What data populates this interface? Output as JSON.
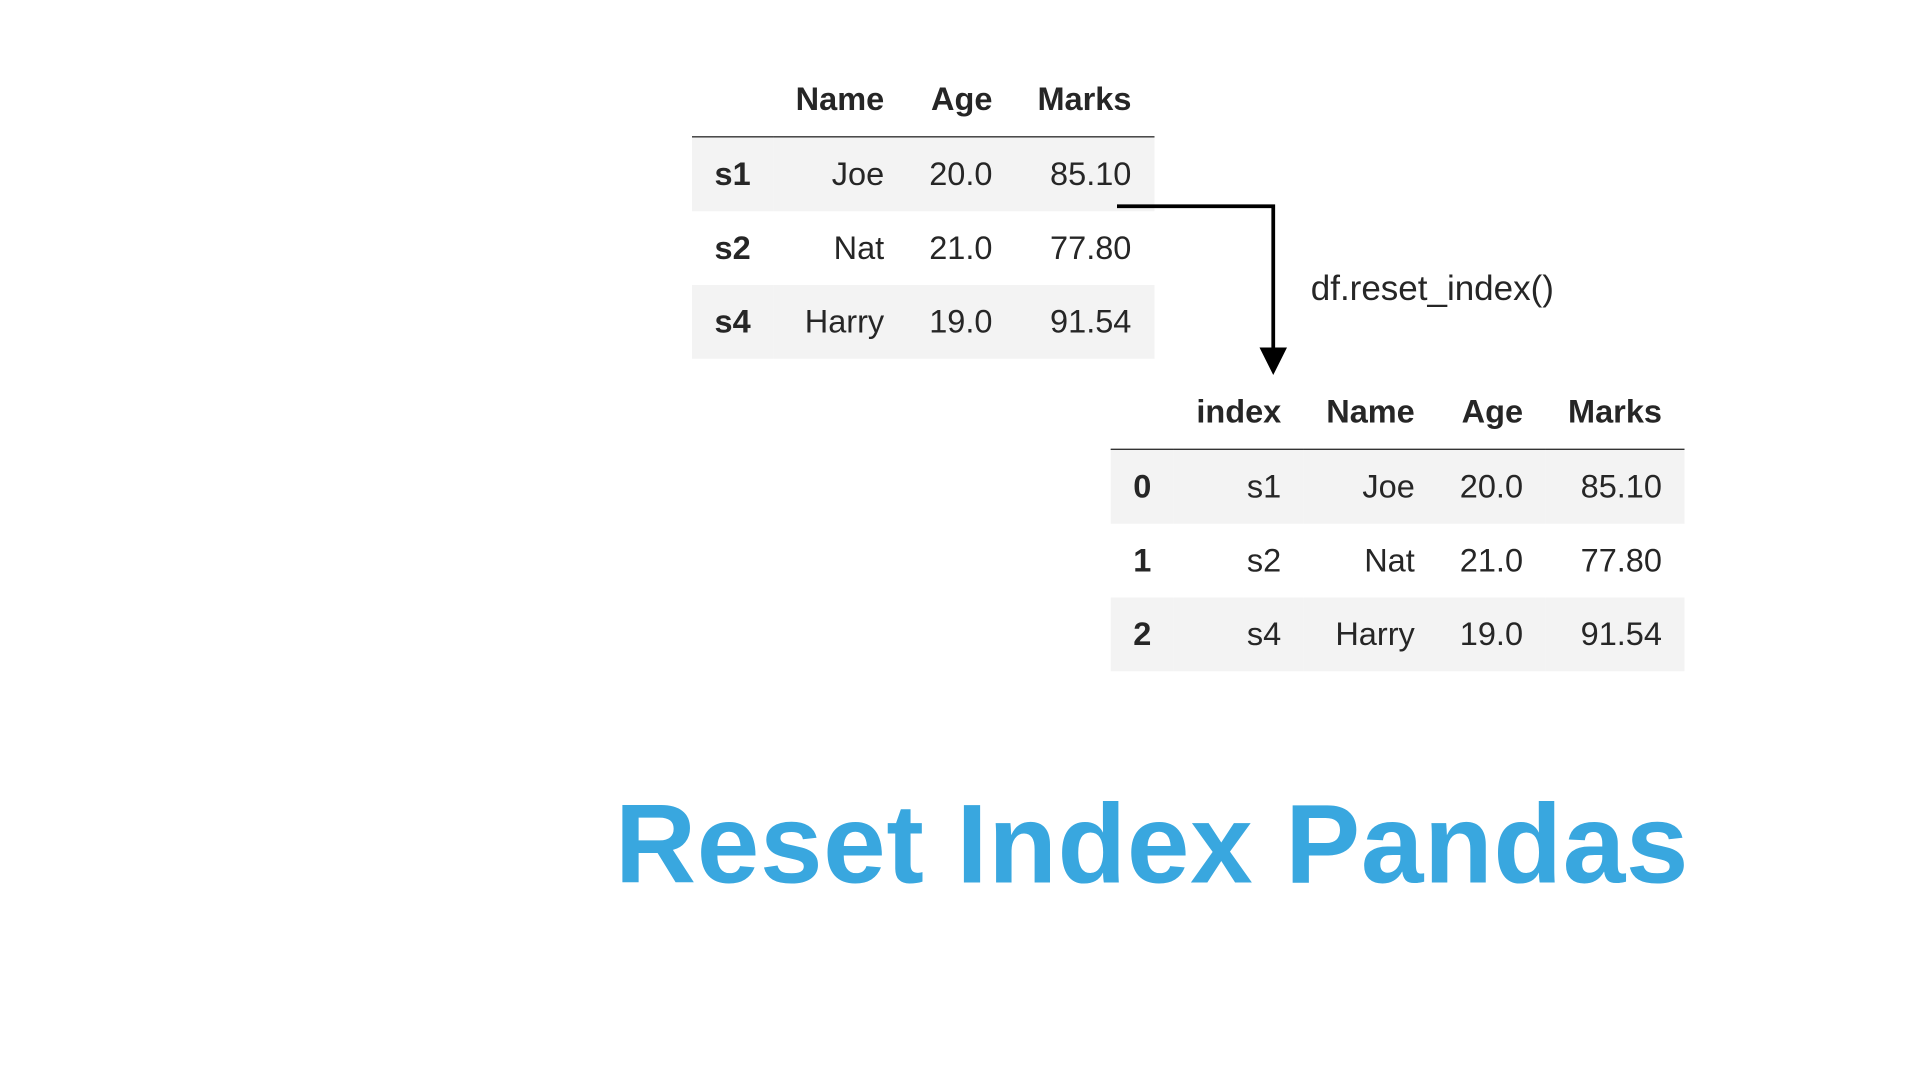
{
  "table1": {
    "columns": [
      "Name",
      "Age",
      "Marks"
    ],
    "rows": [
      {
        "idx": "s1",
        "cells": [
          "Joe",
          "20.0",
          "85.10"
        ]
      },
      {
        "idx": "s2",
        "cells": [
          "Nat",
          "21.0",
          "77.80"
        ]
      },
      {
        "idx": "s4",
        "cells": [
          "Harry",
          "19.0",
          "91.54"
        ]
      }
    ]
  },
  "table2": {
    "columns": [
      "index",
      "Name",
      "Age",
      "Marks"
    ],
    "rows": [
      {
        "idx": "0",
        "cells": [
          "s1",
          "Joe",
          "20.0",
          "85.10"
        ]
      },
      {
        "idx": "1",
        "cells": [
          "s2",
          "Nat",
          "21.0",
          "77.80"
        ]
      },
      {
        "idx": "2",
        "cells": [
          "s4",
          "Harry",
          "19.0",
          "91.54"
        ]
      }
    ]
  },
  "code_label": "df.reset_index()",
  "title": "Reset Index Pandas"
}
